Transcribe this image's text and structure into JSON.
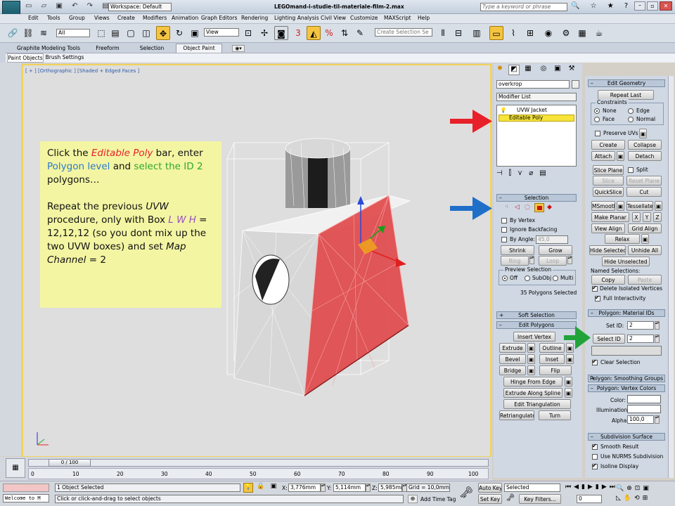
{
  "window": {
    "title": "LEGOmand-i-studie-til-materiale-film-2.max",
    "workspace": "Workspace: Default",
    "search_placeholder": "Type a keyword or phrase"
  },
  "menu": [
    "Edit",
    "Tools",
    "Group",
    "Views",
    "Create",
    "Modifiers",
    "Animation",
    "Graph Editors",
    "Rendering",
    "Lighting Analysis",
    "Civil View",
    "Customize",
    "MAXScript",
    "Help"
  ],
  "toolbar": {
    "filter_value": "All",
    "refcoord_value": "View",
    "selection_set_placeholder": "Create Selection Se"
  },
  "ribbon": {
    "tabs": [
      "Graphite Modeling Tools",
      "Freeform",
      "Selection",
      "Object Paint"
    ],
    "subtabs": [
      "Paint Objects",
      "Brush Settings"
    ]
  },
  "viewport": {
    "label": "[ + ] [Orthographic ] [Shaded + Edged Faces ]"
  },
  "annotation": {
    "p1": [
      "Click the ",
      "Editable Poly",
      " bar, enter ",
      "Polygon level",
      " and ",
      "select the ID 2",
      " polygons…"
    ],
    "p2": [
      "Repeat the previous ",
      "UVW",
      " procedure, only with Box ",
      "L W H",
      " = 12,12,12 (so you dont mix up the two UVW boxes) and set ",
      "Map Channel",
      " = 2"
    ]
  },
  "modify_panel": {
    "object_name": "overkrop",
    "modifier_list": "Modifier List",
    "stack": [
      "UVW Jacket",
      "Editable Poly"
    ],
    "selection": {
      "title": "Selection",
      "by_vertex": "By Vertex",
      "ignore_backfacing": "Ignore Backfacing",
      "by_angle": "By Angle:",
      "by_angle_value": "45,0",
      "shrink": "Shrink",
      "grow": "Grow",
      "ring": "Ring",
      "loop": "Loop",
      "preview_selection": "Preview Selection",
      "preview_opts": [
        "Off",
        "SubObj",
        "Multi"
      ],
      "status": "35 Polygons Selected"
    },
    "soft_selection": "Soft Selection",
    "edit_polygons": {
      "title": "Edit Polygons",
      "insert_vertex": "Insert Vertex",
      "extrude": "Extrude",
      "outline": "Outline",
      "bevel": "Bevel",
      "inset": "Inset",
      "bridge": "Bridge",
      "flip": "Flip",
      "hinge": "Hinge From Edge",
      "extrude_spline": "Extrude Along Spline",
      "edit_triangulation": "Edit Triangulation",
      "retriangulate": "Retriangulate",
      "turn": "Turn"
    }
  },
  "edit_geometry": {
    "title": "Edit Geometry",
    "repeat_last": "Repeat Last",
    "constraints": "Constraints",
    "constraint_opts": [
      "None",
      "Edge",
      "Face",
      "Normal"
    ],
    "preserve_uvs": "Preserve UVs",
    "create": "Create",
    "collapse": "Collapse",
    "attach": "Attach",
    "detach": "Detach",
    "slice_plane": "Slice Plane",
    "split": "Split",
    "slice": "Slice",
    "reset_plane": "Reset Plane",
    "quickslice": "QuickSlice",
    "cut": "Cut",
    "msmooth": "MSmooth",
    "tessellate": "Tessellate",
    "make_planar": "Make Planar",
    "x": "X",
    "y": "Y",
    "z": "Z",
    "view_align": "View Align",
    "grid_align": "Grid Align",
    "relax": "Relax",
    "hide_selected": "Hide Selected",
    "unhide_all": "Unhide All",
    "hide_unselected": "Hide Unselected",
    "named_selections": "Named Selections:",
    "copy": "Copy",
    "paste": "Paste",
    "delete_isolated": "Delete Isolated Vertices",
    "full_interactivity": "Full Interactivity"
  },
  "material_ids": {
    "title": "Polygon: Material IDs",
    "set_id": "Set ID:",
    "set_id_value": "2",
    "select_id": "Select ID",
    "select_id_value": "2",
    "clear_selection": "Clear Selection"
  },
  "smoothing_groups": "Polygon: Smoothing Groups",
  "vertex_colors": {
    "title": "Polygon: Vertex Colors",
    "color": "Color:",
    "illumination": "Illumination:",
    "alpha": "Alpha:",
    "alpha_value": "100,0"
  },
  "subdivision": {
    "title": "Subdivision Surface",
    "smooth_result": "Smooth Result",
    "use_nurms": "Use NURMS Subdivision",
    "isoline": "Isoline Display"
  },
  "timeline": {
    "frame": "0 / 100",
    "ticks": [
      "0",
      "10",
      "20",
      "30",
      "40",
      "50",
      "60",
      "70",
      "80",
      "90",
      "100"
    ]
  },
  "status": {
    "maxscript": "Welcome to M",
    "selected": "1 Object Selected",
    "prompt": "Click or click-and-drag to select objects",
    "x_label": "X:",
    "x": "3,776mm",
    "y_label": "Y:",
    "y": "5,114mm",
    "z_label": "Z:",
    "z": "5,985mm",
    "grid": "Grid = 10,0mm",
    "add_time_tag": "Add Time Tag",
    "auto_key": "Auto Key",
    "set_key": "Set Key",
    "key_mode": "Selected",
    "key_filters": "Key Filters...",
    "frame_value": "0"
  },
  "colors": {
    "arrow_red": "#e8202a",
    "arrow_blue": "#1f6fc9",
    "arrow_green": "#22a33a",
    "selection_red": "#e8484a"
  }
}
